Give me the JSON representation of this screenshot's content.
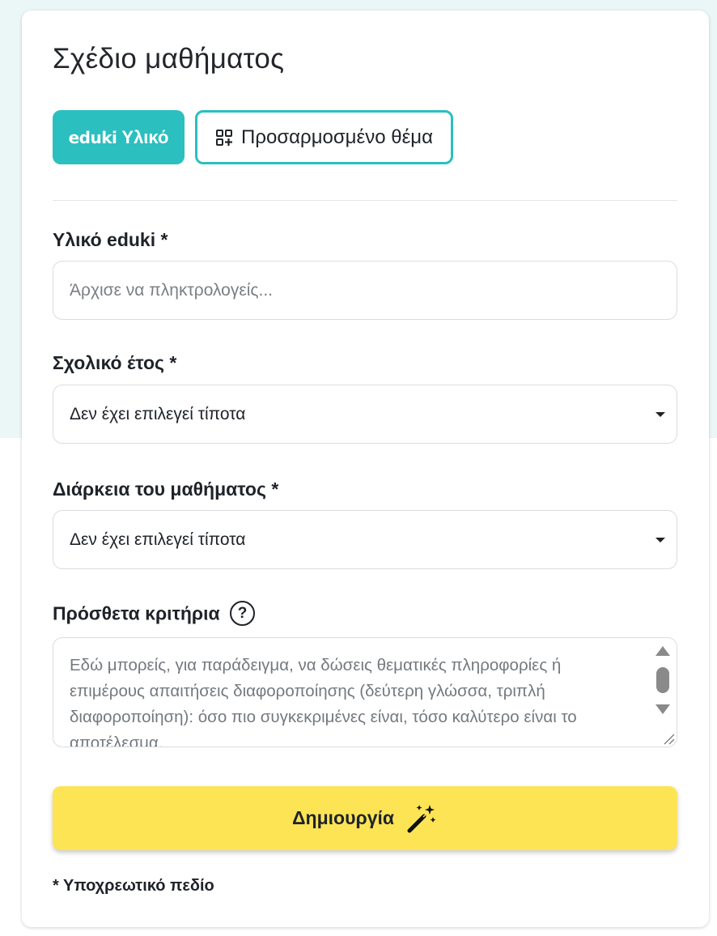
{
  "page": {
    "title": "Σχέδιο μαθήματος"
  },
  "tabs": {
    "eduki": {
      "logo_text": "eduki",
      "label": "Υλικό",
      "icon": "eduki-logo"
    },
    "custom": {
      "label": "Προσαρμοσμένο θέμα",
      "icon": "grid-plus-icon"
    }
  },
  "fields": {
    "material": {
      "label": "Υλικό eduki *",
      "placeholder": "Άρχισε να πληκτρολογείς...",
      "value": ""
    },
    "school_year": {
      "label": "Σχολικό έτος *",
      "selected": "Δεν έχει επιλεγεί τίποτα"
    },
    "duration": {
      "label": "Διάρκεια του μαθήματος *",
      "selected": "Δεν έχει επιλεγεί τίποτα"
    },
    "criteria": {
      "label": "Πρόσθετα κριτήρια",
      "help_icon": "question-circle-icon",
      "placeholder": "Εδώ μπορείς, για παράδειγμα, να δώσεις θεματικές πληροφορίες ή επιμέρους απαιτήσεις διαφοροποίησης (δεύτερη γλώσσα, τριπλή διαφοροποίηση): όσο πιο συγκεκριμένες είναι, τόσο καλύτερο είναι το αποτέλεσμα."
    }
  },
  "create_button": {
    "label": "Δημιουργία",
    "icon": "magic-wand-icon"
  },
  "footnote": "* Υποχρεωτικό πεδίο",
  "colors": {
    "accent": "#2bbfbf",
    "button": "#fde455",
    "background_tint": "#ebf7f7"
  }
}
